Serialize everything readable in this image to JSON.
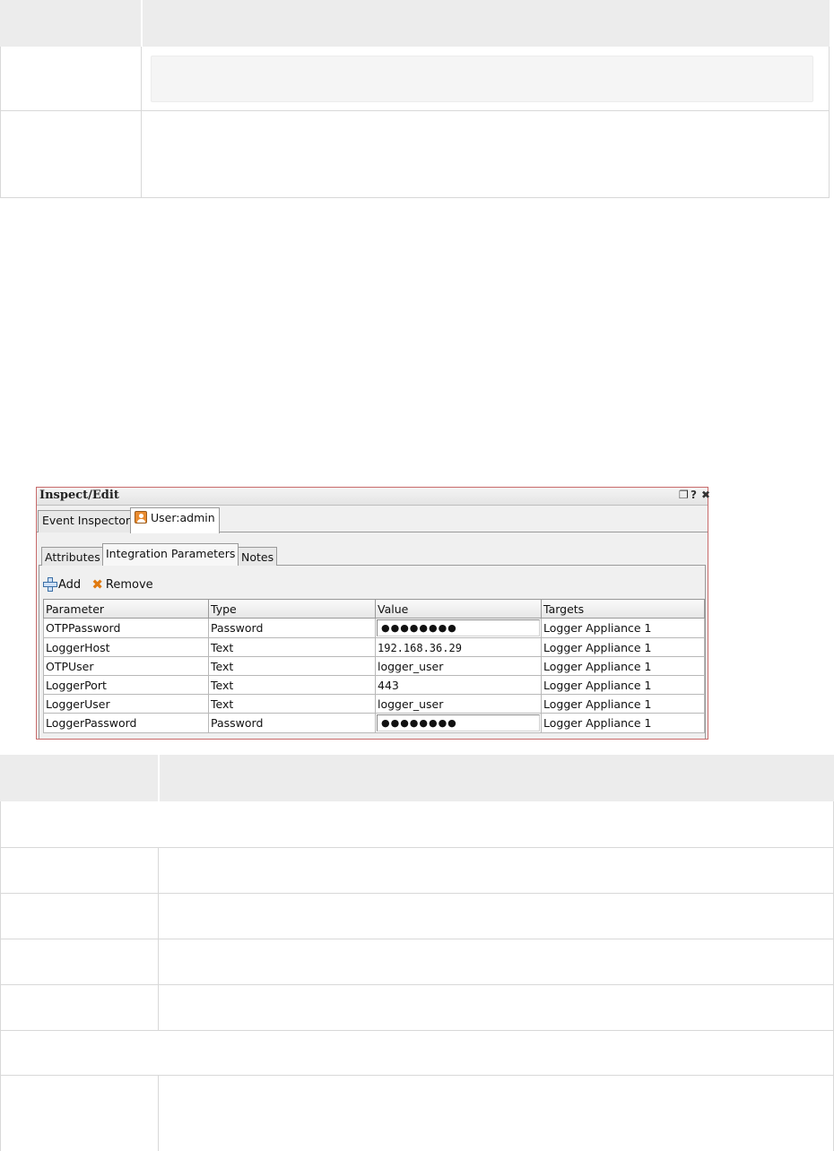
{
  "panel": {
    "title": "Inspect/Edit",
    "controls": {
      "restore": "❐",
      "help": "?",
      "close": "✖"
    },
    "outer_tabs": [
      {
        "label": "Event Inspector"
      },
      {
        "label": "User:admin",
        "icon": "user-icon"
      }
    ],
    "inner_tabs": [
      {
        "label": "Attributes"
      },
      {
        "label": "Integration Parameters"
      },
      {
        "label": "Notes"
      }
    ],
    "active_inner_tab": "Integration Parameters",
    "toolbar": {
      "add_label": "Add",
      "remove_label": "Remove"
    },
    "table": {
      "columns": [
        "Parameter",
        "Type",
        "Value",
        "Targets"
      ],
      "rows": [
        {
          "parameter": "OTPPassword",
          "type": "Password",
          "value": "●●●●●●●●",
          "targets": "Logger Appliance 1"
        },
        {
          "parameter": "LoggerHost",
          "type": "Text",
          "value": "192.168.36.29",
          "targets": "Logger Appliance 1"
        },
        {
          "parameter": "OTPUser",
          "type": "Text",
          "value": "logger_user",
          "targets": "Logger Appliance 1"
        },
        {
          "parameter": "LoggerPort",
          "type": "Text",
          "value": "443",
          "targets": "Logger Appliance 1"
        },
        {
          "parameter": "LoggerUser",
          "type": "Text",
          "value": "logger_user",
          "targets": "Logger Appliance 1"
        },
        {
          "parameter": "LoggerPassword",
          "type": "Password",
          "value": "●●●●●●●●",
          "targets": "Logger Appliance 1"
        }
      ]
    }
  },
  "colors": {
    "doc_header_bg": "#ececec",
    "panel_border": "#c86a6a",
    "remove_icon": "#e07a10",
    "user_icon": "#e98b2f"
  }
}
